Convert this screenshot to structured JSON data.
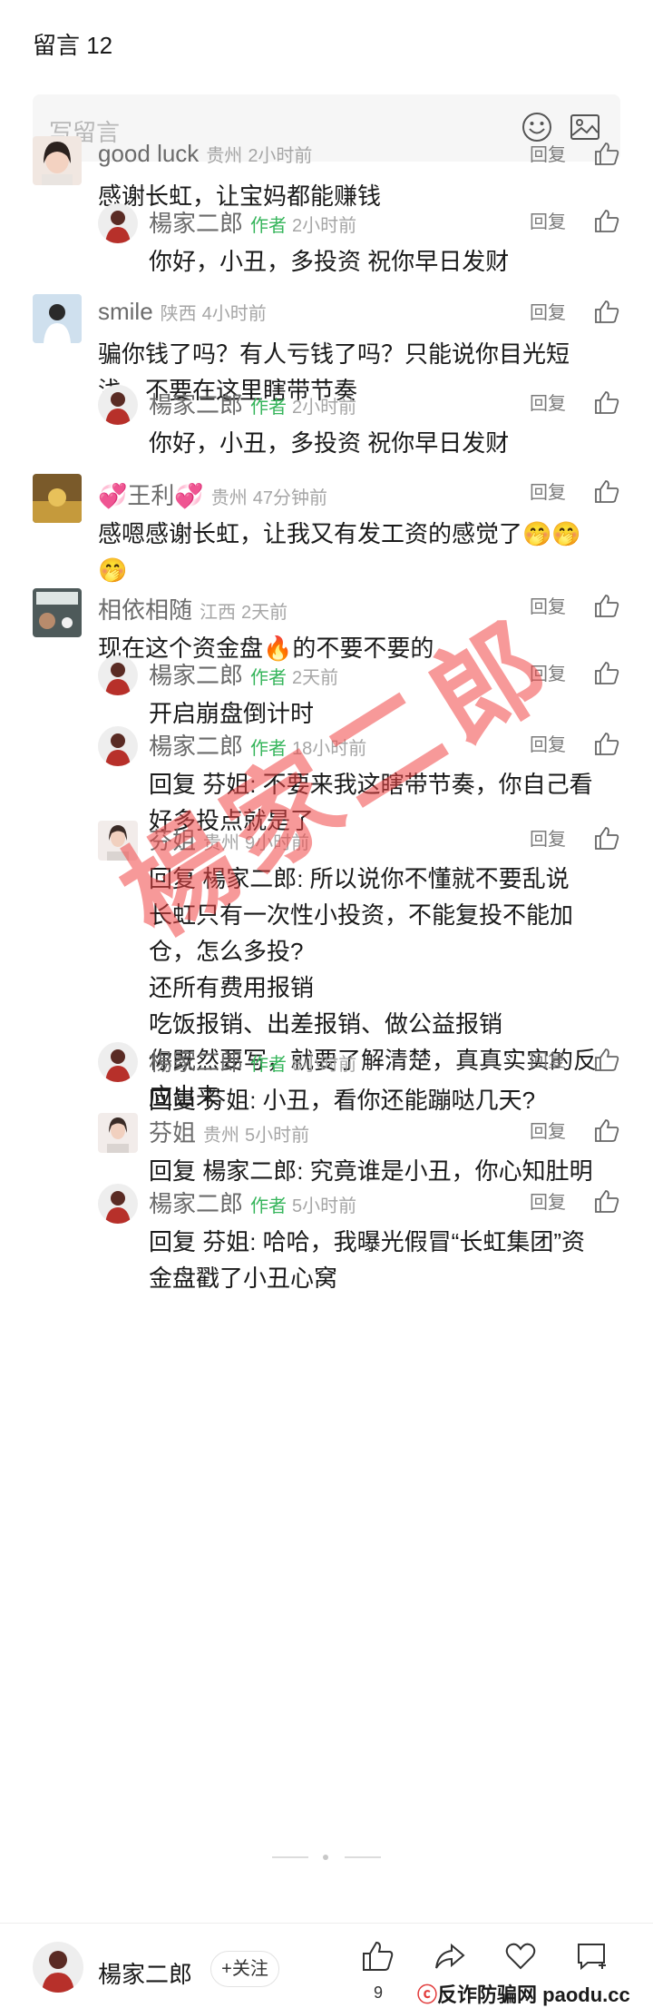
{
  "header": {
    "title": "留言 12"
  },
  "write": {
    "placeholder": "写留言",
    "emoji_icon": "smiley-face-icon",
    "image_icon": "image-icon"
  },
  "common": {
    "reply_label": "回复",
    "author_badge": "作者"
  },
  "comments": [
    {
      "name": "good luck",
      "location": "贵州",
      "time": "2小时前",
      "text": [
        "感谢长虹，让宝妈都能赚钱"
      ],
      "replies": [
        {
          "name": "楊家二郎",
          "time": "2小时前",
          "text": [
            "你好，小丑，多投资 祝你早日发财"
          ]
        }
      ]
    },
    {
      "name": "smile",
      "location": "陕西",
      "time": "4小时前",
      "text": [
        "骗你钱了吗？有人亏钱了吗？只能说你目光短",
        "浅，不要在这里瞎带节奏"
      ],
      "replies": [
        {
          "name": "楊家二郎",
          "time": "2小时前",
          "text": [
            "你好，小丑，多投资 祝你早日发财"
          ]
        }
      ]
    },
    {
      "name": "💞王利💞",
      "location": "贵州",
      "time": "47分钟前",
      "text": [
        "感嗯感谢长虹，让我又有发工资的感觉了🤭🤭",
        "🤭"
      ],
      "replies": []
    },
    {
      "name": "相依相随",
      "location": "江西",
      "time": "2天前",
      "text": [
        "现在这个资金盘🔥的不要不要的"
      ],
      "replies": [
        {
          "name": "楊家二郎",
          "time": "2天前",
          "text": [
            "开启崩盘倒计时"
          ]
        },
        {
          "name": "楊家二郎",
          "time": "18小时前",
          "text": [
            "回复 芬姐: 不要来我这瞎带节奏，你自己看",
            "好多投点就是了"
          ]
        },
        {
          "name": "芬姐",
          "location": "贵州",
          "time": "9小时前",
          "text": [
            "回复 楊家二郎: 所以说你不懂就不要乱说",
            "长虹只有一次性小投资，不能复投不能加",
            "仓，怎么多投?",
            "还所有费用报销",
            "吃饭报销、出差报销、做公益报销",
            "你既然要写，就要了解清楚，真真实实的反",
            "应出来"
          ]
        },
        {
          "name": "楊家二郎",
          "time": "8小时前",
          "text": [
            "回复 芬姐: 小丑，看你还能蹦哒几天?"
          ]
        },
        {
          "name": "芬姐",
          "location": "贵州",
          "time": "5小时前",
          "text": [
            "回复 楊家二郎: 究竟谁是小丑，你心知肚明"
          ]
        },
        {
          "name": "楊家二郎",
          "time": "5小时前",
          "text": [
            "回复 芬姐: 哈哈，我曝光假冒“长虹集团”资",
            "金盘戳了小丑心窝"
          ]
        }
      ]
    }
  ],
  "watermark": "楊家二郎",
  "bottom_bar": {
    "name": "楊家二郎",
    "follow_label": "+关注",
    "like_count": "9",
    "share_count": "",
    "site_watermark_prefix": "反诈防骗网",
    "site_watermark_domain": "paodu.cc"
  }
}
